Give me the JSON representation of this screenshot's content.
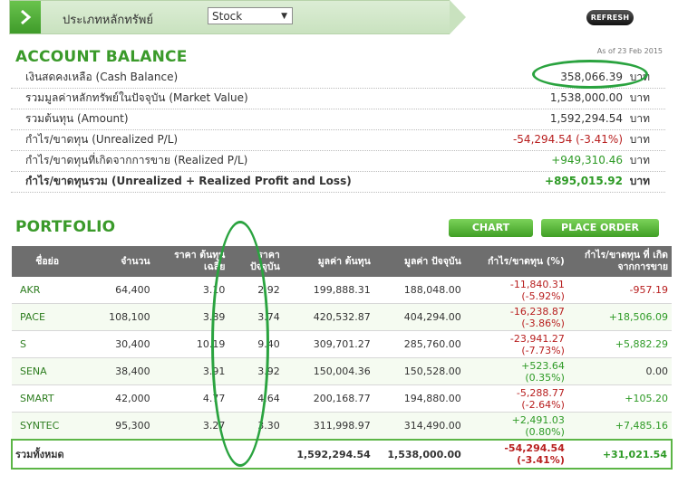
{
  "header": {
    "asset_label": "ประเภทหลักทรัพย์",
    "asset_value": "Stock",
    "refresh": "REFRESH"
  },
  "account": {
    "title": "ACCOUNT BALANCE",
    "as_of": "As of 23 Feb 2015",
    "rows": [
      {
        "label": "เงินสดคงเหลือ (Cash Balance)",
        "value": "358,066.39",
        "unit": "บาท"
      },
      {
        "label": "รวมมูลค่าหลักทรัพย์ในปัจจุบัน (Market Value)",
        "value": "1,538,000.00",
        "unit": "บาท"
      },
      {
        "label": "รวมต้นทุน (Amount)",
        "value": "1,592,294.54",
        "unit": "บาท"
      },
      {
        "label": "กำไร/ขาดทุน (Unrealized P/L)",
        "value": "-54,294.54 (-3.41%)",
        "unit": "บาท"
      },
      {
        "label": "กำไร/ขาดทุนที่เกิดจากการขาย (Realized P/L)",
        "value": "+949,310.46",
        "unit": "บาท"
      },
      {
        "label": "กำไร/ขาดทุนรวม (Unrealized + Realized Profit and Loss)",
        "value": "+895,015.92",
        "unit": "บาท"
      }
    ]
  },
  "portfolio": {
    "title": "PORTFOLIO",
    "chart_btn": "CHART",
    "order_btn": "PLACE ORDER",
    "headers": [
      "ชื่อย่อ",
      "จำนวน",
      "ราคา ต้นทุนเฉลี่ย",
      "ราคา ปัจจุบัน",
      "มูลค่า ต้นทุน",
      "มูลค่า ปัจจุบัน",
      "กำไร/ขาดทุน (%)",
      "กำไร/ขาดทุน ที่ เกิดจากการขาย"
    ],
    "rows": [
      {
        "sym": "AKR",
        "qty": "64,400",
        "avg": "3.10",
        "last": "2.92",
        "cost": "199,888.31",
        "mkt": "188,048.00",
        "pl": "-11,840.31",
        "plpct": "(-5.92%)",
        "rpl": "-957.19"
      },
      {
        "sym": "PACE",
        "qty": "108,100",
        "avg": "3.89",
        "last": "3.74",
        "cost": "420,532.87",
        "mkt": "404,294.00",
        "pl": "-16,238.87",
        "plpct": "(-3.86%)",
        "rpl": "+18,506.09"
      },
      {
        "sym": "S",
        "qty": "30,400",
        "avg": "10.19",
        "last": "9.40",
        "cost": "309,701.27",
        "mkt": "285,760.00",
        "pl": "-23,941.27",
        "plpct": "(-7.73%)",
        "rpl": "+5,882.29"
      },
      {
        "sym": "SENA",
        "qty": "38,400",
        "avg": "3.91",
        "last": "3.92",
        "cost": "150,004.36",
        "mkt": "150,528.00",
        "pl": "+523.64",
        "plpct": "(0.35%)",
        "rpl": "0.00"
      },
      {
        "sym": "SMART",
        "qty": "42,000",
        "avg": "4.77",
        "last": "4.64",
        "cost": "200,168.77",
        "mkt": "194,880.00",
        "pl": "-5,288.77",
        "plpct": "(-2.64%)",
        "rpl": "+105.20"
      },
      {
        "sym": "SYNTEC",
        "qty": "95,300",
        "avg": "3.27",
        "last": "3.30",
        "cost": "311,998.97",
        "mkt": "314,490.00",
        "pl": "+2,491.03",
        "plpct": "(0.80%)",
        "rpl": "+7,485.16"
      }
    ],
    "total": {
      "label": "รวมทั้งหมด",
      "cost": "1,592,294.54",
      "mkt": "1,538,000.00",
      "pl": "-54,294.54",
      "plpct": "(-3.41%)",
      "rpl": "+31,021.54"
    }
  },
  "colors": {
    "green_title": "#3a9a2a",
    "loss": "#b81f1f",
    "gain": "#2d9a25",
    "annotation": "#2aa33f"
  }
}
